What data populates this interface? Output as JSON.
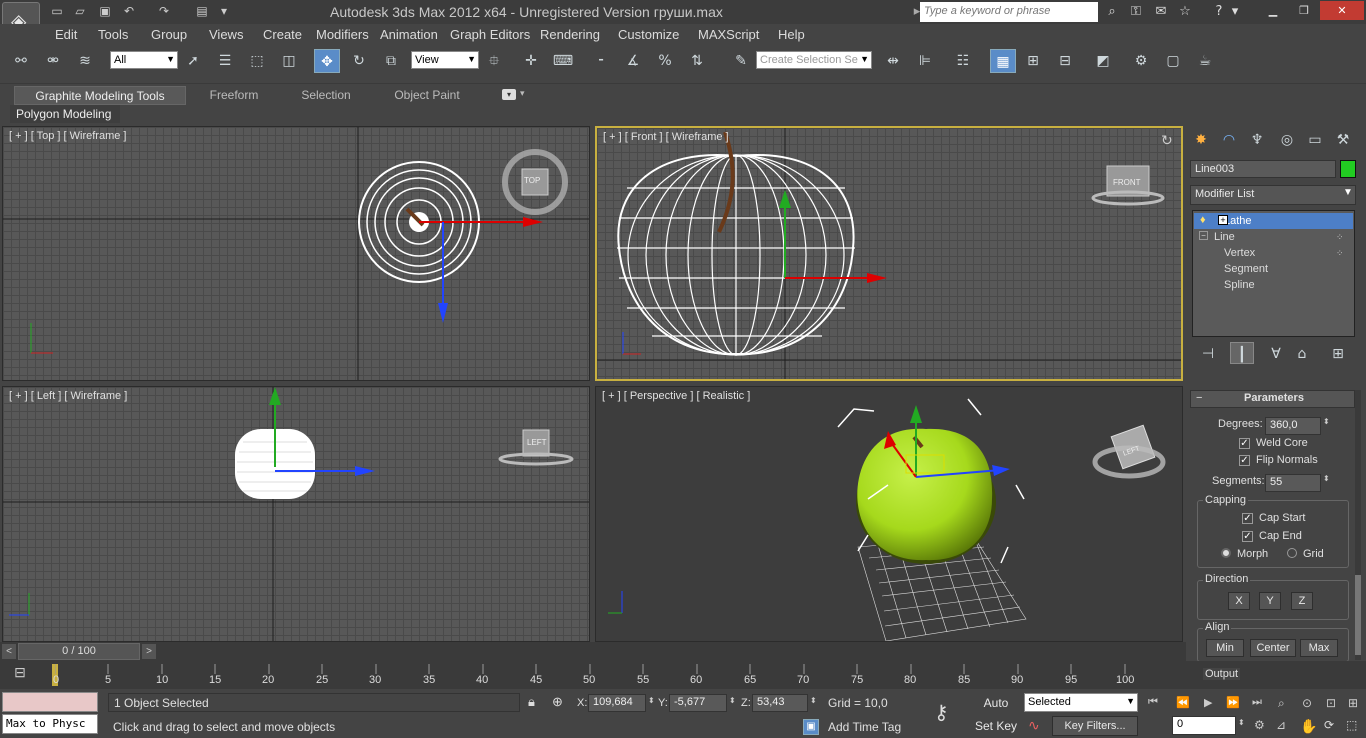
{
  "window": {
    "title": "Autodesk 3ds Max  2012 x64  -  Unregistered Version    груши.max",
    "search_placeholder": "Type a keyword or phrase",
    "app_glyph": "◈"
  },
  "menu": [
    "Edit",
    "Tools",
    "Group",
    "Views",
    "Create",
    "Modifiers",
    "Animation",
    "Graph Editors",
    "Rendering",
    "Customize",
    "MAXScript",
    "Help"
  ],
  "toolbar": {
    "filter_value": "All",
    "ref_coord": "View",
    "selection_set_placeholder": "Create Selection Se"
  },
  "ribbon": {
    "tabs": [
      "Graphite Modeling Tools",
      "Freeform",
      "Selection",
      "Object Paint"
    ],
    "panel_label": "Polygon Modeling"
  },
  "viewports": {
    "top": {
      "label": "[ + ] [ Top ] [ Wireframe ]",
      "cube": "TOP"
    },
    "front": {
      "label": "[ + ] [ Front ] [ Wireframe ]",
      "cube": "FRONT"
    },
    "left": {
      "label": "[ + ] [ Left ] [ Wireframe ]",
      "cube": "LEFT"
    },
    "perspective": {
      "label": "[ + ] [ Perspective ] [ Realistic ]",
      "cube": "LEFT"
    }
  },
  "command_panel": {
    "object_name": "Line003",
    "object_color": "#22cc22",
    "modifier_list": "Modifier List",
    "stack": [
      {
        "label": "Lathe",
        "selected": true
      },
      {
        "label": "Line",
        "selected": false
      },
      {
        "label": "Vertex",
        "sub": true
      },
      {
        "label": "Segment",
        "sub": true
      },
      {
        "label": "Spline",
        "sub": true
      }
    ],
    "rollout": "Parameters",
    "degrees_label": "Degrees:",
    "degrees": "360,0",
    "weld_core": "Weld Core",
    "flip_normals": "Flip Normals",
    "segments_label": "Segments:",
    "segments": "55",
    "capping": "Capping",
    "cap_start": "Cap Start",
    "cap_end": "Cap End",
    "morph": "Morph",
    "grid": "Grid",
    "direction": "Direction",
    "dir_x": "X",
    "dir_y": "Y",
    "dir_z": "Z",
    "align": "Align",
    "align_min": "Min",
    "align_center": "Center",
    "align_max": "Max",
    "output": "Output"
  },
  "timeline": {
    "frame": "0 / 100",
    "ticks": [
      "0",
      "5",
      "10",
      "15",
      "20",
      "25",
      "30",
      "35",
      "40",
      "45",
      "50",
      "55",
      "60",
      "65",
      "70",
      "75",
      "80",
      "85",
      "90",
      "95",
      "100"
    ]
  },
  "status": {
    "maxscript": "Max to Physc",
    "selected_count": "1 Object Selected",
    "prompt": "Click and drag to select and move objects",
    "x_label": "X:",
    "x": "109,684",
    "y_label": "Y:",
    "y": "-5,677",
    "z_label": "Z:",
    "z": "53,43",
    "grid": "Grid = 10,0",
    "add_time_tag": "Add Time Tag",
    "auto_key": "Auto Key",
    "set_key": "Set Key",
    "key_mode": "Selected",
    "key_filters": "Key Filters...",
    "current_frame": "0"
  },
  "colors": {
    "accent": "#5a8cc8",
    "apple_green": "#a6d91c",
    "active_border": "#c8b040"
  }
}
